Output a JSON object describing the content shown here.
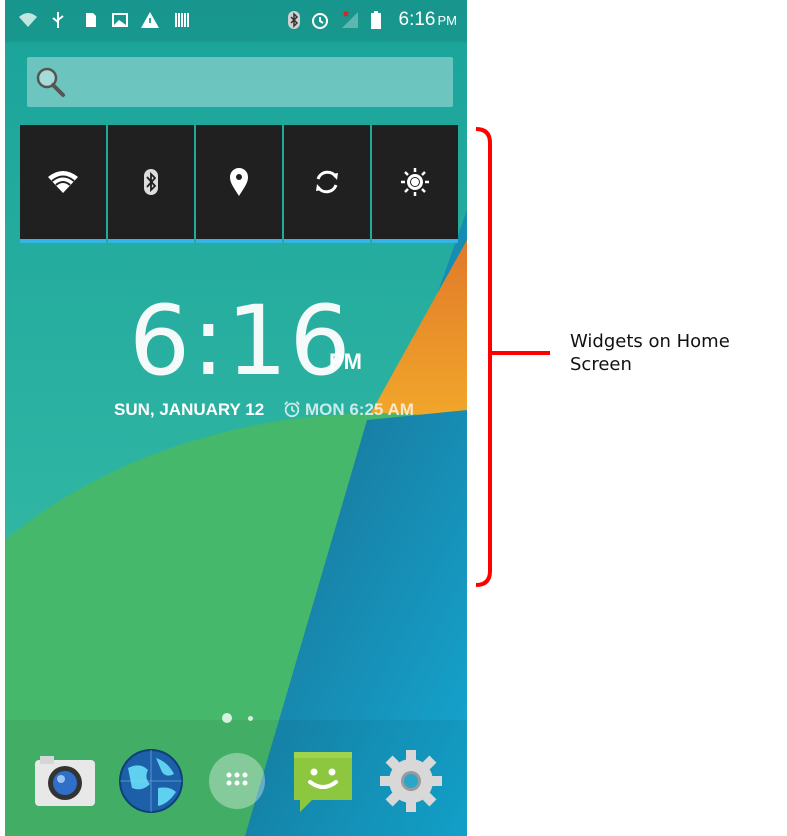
{
  "status_bar": {
    "icons_left": [
      "wifi-question-icon",
      "usb-icon",
      "sim-card-icon",
      "image-icon",
      "warning-icon",
      "barcode-icon"
    ],
    "icons_right": [
      "bluetooth-icon",
      "alarm-icon",
      "signal-icon",
      "battery-icon"
    ],
    "time": "6:16",
    "ampm": "PM"
  },
  "search": {
    "icon": "search-icon"
  },
  "quick_toggles": [
    {
      "name": "wifi",
      "icon": "wifi-icon"
    },
    {
      "name": "bluetooth",
      "icon": "bluetooth-icon"
    },
    {
      "name": "location",
      "icon": "location-icon"
    },
    {
      "name": "sync",
      "icon": "sync-icon"
    },
    {
      "name": "brightness",
      "icon": "brightness-icon"
    }
  ],
  "clock": {
    "time": "6:16",
    "ampm": "PM",
    "date": "SUN, JANUARY 12",
    "alarm": "MON 6:25 AM"
  },
  "page_indicator": {
    "pages": 2,
    "current": 1
  },
  "dock": [
    {
      "name": "camera",
      "icon": "camera-icon"
    },
    {
      "name": "browser",
      "icon": "globe-icon"
    },
    {
      "name": "app-drawer",
      "icon": "app-drawer-icon"
    },
    {
      "name": "messaging",
      "icon": "messaging-icon"
    },
    {
      "name": "settings",
      "icon": "gear-icon"
    }
  ],
  "annotation": {
    "line1": "Widgets on Home",
    "line2": "Screen",
    "color": "#ff0000"
  },
  "colors": {
    "accent": "#33b5e5",
    "toggle_bg": "#202020"
  }
}
